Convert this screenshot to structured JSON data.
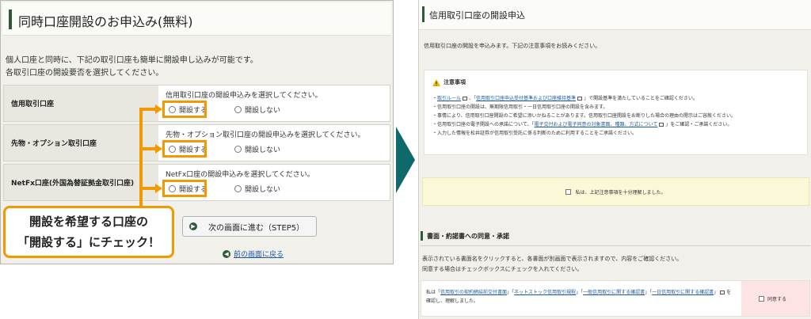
{
  "left": {
    "title": "同時口座開設のお申込み(無料)",
    "intro": [
      "個人口座と同時に、下記の取引口座も簡単に開設申し込みが可能です。",
      "各取引口座の開設要否を選択してください。"
    ],
    "accounts": [
      {
        "name": "信用取引口座",
        "message": "信用取引口座の開設申込みを選択してください。",
        "open_label": "開設する",
        "no_label": "開設しない"
      },
      {
        "name": "先物・オプション取引口座",
        "message": "先物・オプション取引口座の開設申込みを選択してください。",
        "open_label": "開設する",
        "no_label": "開設しない"
      },
      {
        "name": "NetFx口座(外国為替証拠金取引口座)",
        "message": "NetFx口座の開設申込みを選択してください。",
        "open_label": "開設する",
        "no_label": "開設しない"
      }
    ],
    "callout": [
      "開設を希望する口座の",
      "「開設する」にチェック！"
    ],
    "next_button": "次の画面に進む（STEP5）",
    "back_link": "前の画面に戻る",
    "highlight_color": "#f39800"
  },
  "right": {
    "title": "信用取引口座の開設申込",
    "intro": "信用取引口座の開設を申込みます。下記の注意事項をお読みください。",
    "notice": {
      "heading": "注意事項",
      "items": [
        [
          "・",
          "取引ルール",
          "、「",
          "信用取引口座申込受付基準および口座維持基準",
          "」で開設基準を満たしていることをご確認ください。"
        ],
        [
          "・信用取引口座の開設は、無期限信用取引・一日信用取引口座の開設を含みます。",
          "",
          "",
          "",
          ""
        ],
        [
          "・事情により、信用取引口座開設のご希望に添いかねることがあります。信用取引口座開設をお断りした場合の理由の開示はご容赦ください。",
          "",
          "",
          "",
          ""
        ],
        [
          "・信用取引口座の電子開設への承諾について、「",
          "電子交付および電子同意の対象書面、種類、方式について",
          "」をご確認・ご承諾ください。",
          "",
          ""
        ],
        [
          "・入力した情報を松井証券が信用取引受託に係る判断のために利用することをご承諾ください。",
          "",
          "",
          "",
          ""
        ]
      ]
    },
    "agree_label": "私は、上記注意事項を十分理解しました。",
    "section_title": "書面・約諾書への同意・承諾",
    "section_intro": [
      "表示されている書面名をクリックすると、各書面が別画面で表示されますので、内容をご確認ください。",
      "同意する場合はチェックボックスにチェックを入れてください。"
    ],
    "doc": {
      "prefix": "私は「",
      "links": [
        "信用取引の契約締結前交付書面",
        "ネットストック信用取引規程",
        "一般信用取引に関する確認書",
        "一日信用取引に関する確認書"
      ],
      "suffix": "を確認し、理解しました。",
      "consent_label": "同意する"
    }
  },
  "colors": {
    "theme_green": "#2e5a36",
    "arrow": "#0e6a6a"
  }
}
